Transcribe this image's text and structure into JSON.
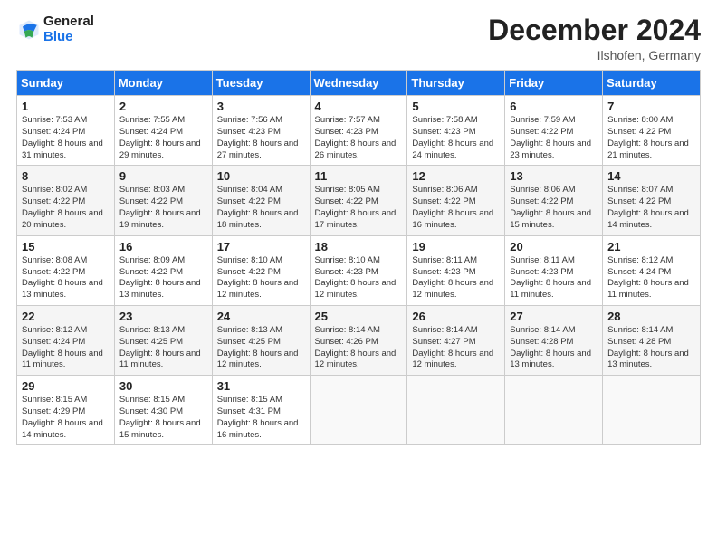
{
  "header": {
    "logo_general": "General",
    "logo_blue": "Blue",
    "month_title": "December 2024",
    "location": "Ilshofen, Germany"
  },
  "days_of_week": [
    "Sunday",
    "Monday",
    "Tuesday",
    "Wednesday",
    "Thursday",
    "Friday",
    "Saturday"
  ],
  "weeks": [
    [
      {
        "day": "1",
        "sunrise": "7:53 AM",
        "sunset": "4:24 PM",
        "daylight": "8 hours and 31 minutes."
      },
      {
        "day": "2",
        "sunrise": "7:55 AM",
        "sunset": "4:24 PM",
        "daylight": "8 hours and 29 minutes."
      },
      {
        "day": "3",
        "sunrise": "7:56 AM",
        "sunset": "4:23 PM",
        "daylight": "8 hours and 27 minutes."
      },
      {
        "day": "4",
        "sunrise": "7:57 AM",
        "sunset": "4:23 PM",
        "daylight": "8 hours and 26 minutes."
      },
      {
        "day": "5",
        "sunrise": "7:58 AM",
        "sunset": "4:23 PM",
        "daylight": "8 hours and 24 minutes."
      },
      {
        "day": "6",
        "sunrise": "7:59 AM",
        "sunset": "4:22 PM",
        "daylight": "8 hours and 23 minutes."
      },
      {
        "day": "7",
        "sunrise": "8:00 AM",
        "sunset": "4:22 PM",
        "daylight": "8 hours and 21 minutes."
      }
    ],
    [
      {
        "day": "8",
        "sunrise": "8:02 AM",
        "sunset": "4:22 PM",
        "daylight": "8 hours and 20 minutes."
      },
      {
        "day": "9",
        "sunrise": "8:03 AM",
        "sunset": "4:22 PM",
        "daylight": "8 hours and 19 minutes."
      },
      {
        "day": "10",
        "sunrise": "8:04 AM",
        "sunset": "4:22 PM",
        "daylight": "8 hours and 18 minutes."
      },
      {
        "day": "11",
        "sunrise": "8:05 AM",
        "sunset": "4:22 PM",
        "daylight": "8 hours and 17 minutes."
      },
      {
        "day": "12",
        "sunrise": "8:06 AM",
        "sunset": "4:22 PM",
        "daylight": "8 hours and 16 minutes."
      },
      {
        "day": "13",
        "sunrise": "8:06 AM",
        "sunset": "4:22 PM",
        "daylight": "8 hours and 15 minutes."
      },
      {
        "day": "14",
        "sunrise": "8:07 AM",
        "sunset": "4:22 PM",
        "daylight": "8 hours and 14 minutes."
      }
    ],
    [
      {
        "day": "15",
        "sunrise": "8:08 AM",
        "sunset": "4:22 PM",
        "daylight": "8 hours and 13 minutes."
      },
      {
        "day": "16",
        "sunrise": "8:09 AM",
        "sunset": "4:22 PM",
        "daylight": "8 hours and 13 minutes."
      },
      {
        "day": "17",
        "sunrise": "8:10 AM",
        "sunset": "4:22 PM",
        "daylight": "8 hours and 12 minutes."
      },
      {
        "day": "18",
        "sunrise": "8:10 AM",
        "sunset": "4:23 PM",
        "daylight": "8 hours and 12 minutes."
      },
      {
        "day": "19",
        "sunrise": "8:11 AM",
        "sunset": "4:23 PM",
        "daylight": "8 hours and 12 minutes."
      },
      {
        "day": "20",
        "sunrise": "8:11 AM",
        "sunset": "4:23 PM",
        "daylight": "8 hours and 11 minutes."
      },
      {
        "day": "21",
        "sunrise": "8:12 AM",
        "sunset": "4:24 PM",
        "daylight": "8 hours and 11 minutes."
      }
    ],
    [
      {
        "day": "22",
        "sunrise": "8:12 AM",
        "sunset": "4:24 PM",
        "daylight": "8 hours and 11 minutes."
      },
      {
        "day": "23",
        "sunrise": "8:13 AM",
        "sunset": "4:25 PM",
        "daylight": "8 hours and 11 minutes."
      },
      {
        "day": "24",
        "sunrise": "8:13 AM",
        "sunset": "4:25 PM",
        "daylight": "8 hours and 12 minutes."
      },
      {
        "day": "25",
        "sunrise": "8:14 AM",
        "sunset": "4:26 PM",
        "daylight": "8 hours and 12 minutes."
      },
      {
        "day": "26",
        "sunrise": "8:14 AM",
        "sunset": "4:27 PM",
        "daylight": "8 hours and 12 minutes."
      },
      {
        "day": "27",
        "sunrise": "8:14 AM",
        "sunset": "4:28 PM",
        "daylight": "8 hours and 13 minutes."
      },
      {
        "day": "28",
        "sunrise": "8:14 AM",
        "sunset": "4:28 PM",
        "daylight": "8 hours and 13 minutes."
      }
    ],
    [
      {
        "day": "29",
        "sunrise": "8:15 AM",
        "sunset": "4:29 PM",
        "daylight": "8 hours and 14 minutes."
      },
      {
        "day": "30",
        "sunrise": "8:15 AM",
        "sunset": "4:30 PM",
        "daylight": "8 hours and 15 minutes."
      },
      {
        "day": "31",
        "sunrise": "8:15 AM",
        "sunset": "4:31 PM",
        "daylight": "8 hours and 16 minutes."
      },
      null,
      null,
      null,
      null
    ]
  ]
}
